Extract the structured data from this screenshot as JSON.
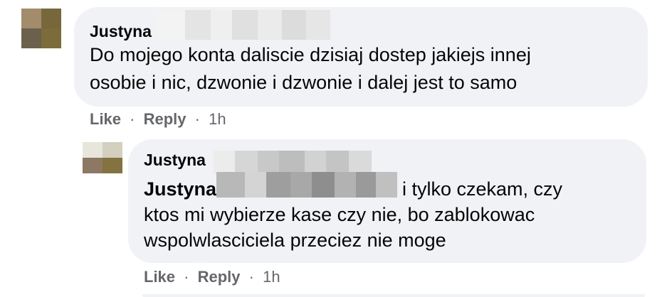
{
  "comments": [
    {
      "author": "Justyna",
      "lines": [
        "Do mojego konta daliscie dzisiaj dostep jakiejs innej",
        "osobie i nic, dzwonie i dzwonie i dalej jest to samo"
      ],
      "actions": {
        "like": "Like",
        "reply": "Reply",
        "dot": "·",
        "time": "1h"
      }
    },
    {
      "author": "Justyna",
      "mention": "Justyna",
      "line1_rest": "i tylko czekam, czy",
      "lines": [
        "ktos mi wybierze kase czy nie, bo zablokowac",
        "wspolwlasciciela przeciez nie moge"
      ],
      "actions": {
        "like": "Like",
        "reply": "Reply",
        "dot": "·",
        "time": "1h"
      }
    }
  ],
  "colors": {
    "bubble": "#f0f2f5",
    "text": "#050505",
    "secondary": "#65676b"
  }
}
